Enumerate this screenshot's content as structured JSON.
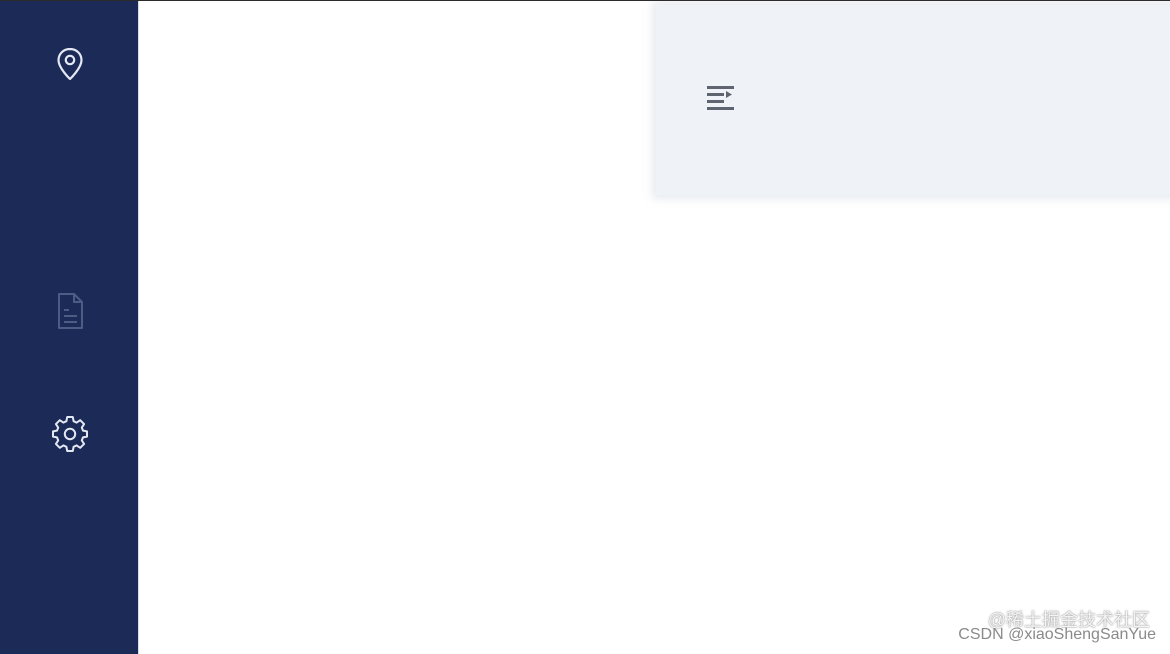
{
  "sidebar": {
    "background": "#1c2a58",
    "items": [
      {
        "icon": "location-pin-icon",
        "state": "active"
      },
      {
        "icon": "document-icon",
        "state": "inactive"
      },
      {
        "icon": "settings-icon",
        "state": "active"
      }
    ]
  },
  "panel": {
    "background": "#eff3f8",
    "toggle_icon": "menu-fold-icon"
  },
  "watermark": {
    "overlay_text": "@稀土掘金技术社区",
    "credit_text": "CSDN @xiaoShengSanYue"
  }
}
